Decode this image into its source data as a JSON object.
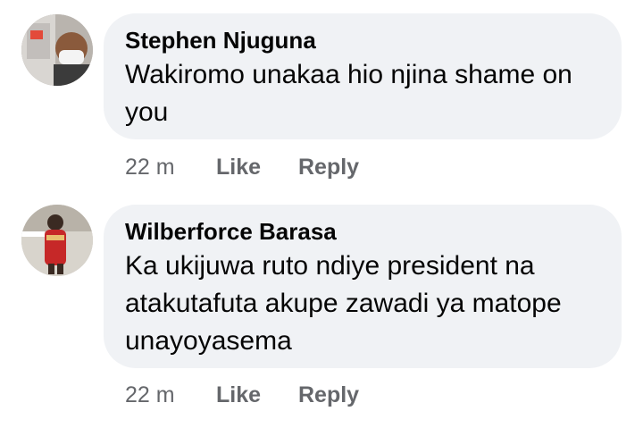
{
  "comments": [
    {
      "author": "Stephen Njuguna",
      "text": "Wakiromo unakaa hio njina shame on you",
      "time": "22 m",
      "like_label": "Like",
      "reply_label": "Reply"
    },
    {
      "author": "Wilberforce Barasa",
      "text": "Ka ukijuwa ruto ndiye president na atakutafuta akupe zawadi ya matope unayoyasema",
      "time": "22 m",
      "like_label": "Like",
      "reply_label": "Reply"
    }
  ],
  "colors": {
    "bubble_bg": "#f0f2f5",
    "text": "#050505",
    "meta_text": "#65676b"
  }
}
